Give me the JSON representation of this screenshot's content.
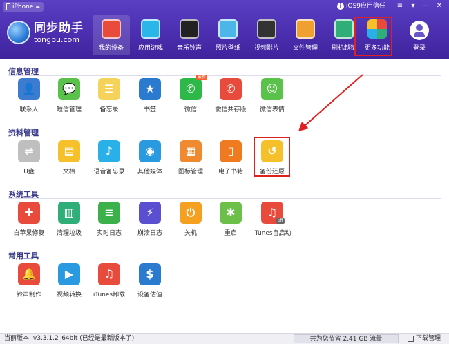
{
  "titlebar": {
    "device": "iPhone",
    "trust_text": "iOS9应用信任"
  },
  "logo": {
    "cn": "同步助手",
    "en": "tongbu.com"
  },
  "nav": [
    {
      "label": "我的设备",
      "icon": "store-icon",
      "color": "#e84a3c"
    },
    {
      "label": "应用游戏",
      "icon": "app-store-icon",
      "color": "#2ab6e8"
    },
    {
      "label": "音乐铃声",
      "icon": "vinyl-record-icon",
      "color": "#222222"
    },
    {
      "label": "照片壁纸",
      "icon": "photo-icon",
      "color": "#4db6e8"
    },
    {
      "label": "视频影片",
      "icon": "clapperboard-icon",
      "color": "#333333"
    },
    {
      "label": "文件管理",
      "icon": "envelope-icon",
      "color": "#f0a030"
    },
    {
      "label": "刷机越狱",
      "icon": "refresh-icon",
      "color": "#2fae7a"
    },
    {
      "label": "更多功能",
      "icon": "grid-icon",
      "color": "#f5c02a"
    },
    {
      "label": "登录",
      "icon": "user-icon",
      "color": "#ffffff"
    }
  ],
  "sections": [
    {
      "title": "信息管理",
      "items": [
        {
          "label": "联系人",
          "icon": "contacts-icon",
          "color": "#3b7bd0",
          "glyph": "👤"
        },
        {
          "label": "短信管理",
          "icon": "message-icon",
          "color": "#5ac24a",
          "glyph": "💬"
        },
        {
          "label": "备忘录",
          "icon": "notes-icon",
          "color": "#f5d25a",
          "glyph": "☰"
        },
        {
          "label": "书签",
          "icon": "bookmark-icon",
          "color": "#2a7bd0",
          "glyph": "★"
        },
        {
          "label": "微信",
          "icon": "wechat-icon",
          "color": "#2fb84a",
          "glyph": "✆",
          "badge": "最新"
        },
        {
          "label": "微信共存版",
          "icon": "wechat-dual-icon",
          "color": "#e84a3c",
          "glyph": "✆"
        },
        {
          "label": "微信表情",
          "icon": "smiley-icon",
          "color": "#5ac24a",
          "glyph": "☺"
        }
      ]
    },
    {
      "title": "资料管理",
      "items": [
        {
          "label": "U盘",
          "icon": "usb-drive-icon",
          "color": "#bfbfbf",
          "glyph": "⇌"
        },
        {
          "label": "文档",
          "icon": "folder-icon",
          "color": "#f5c02a",
          "glyph": "▤"
        },
        {
          "label": "语音备忘录",
          "icon": "microphone-icon",
          "color": "#2ab0e8",
          "glyph": "♪"
        },
        {
          "label": "其他媒体",
          "icon": "media-icon",
          "color": "#2a9ae0",
          "glyph": "◉"
        },
        {
          "label": "图标管理",
          "icon": "icon-grid-icon",
          "color": "#f08a30",
          "glyph": "▦"
        },
        {
          "label": "电子书籍",
          "icon": "book-icon",
          "color": "#f07a20",
          "glyph": "▯"
        },
        {
          "label": "备份还原",
          "icon": "backup-restore-icon",
          "color": "#f5c02a",
          "glyph": "↺"
        }
      ]
    },
    {
      "title": "系统工具",
      "items": [
        {
          "label": "白苹果修复",
          "icon": "apple-repair-icon",
          "color": "#e84a3c",
          "glyph": "✚"
        },
        {
          "label": "清理垃圾",
          "icon": "trash-icon",
          "color": "#2fae7a",
          "glyph": "▥"
        },
        {
          "label": "实时日志",
          "icon": "realtime-log-icon",
          "color": "#3cb04a",
          "glyph": "≡"
        },
        {
          "label": "崩溃日志",
          "icon": "crash-log-icon",
          "color": "#5a4fd0",
          "glyph": "⚡"
        },
        {
          "label": "关机",
          "icon": "power-icon",
          "color": "#f5a020",
          "glyph": "⏻"
        },
        {
          "label": "重启",
          "icon": "restart-icon",
          "color": "#6cc04a",
          "glyph": "✱"
        },
        {
          "label": "iTunes自启动",
          "icon": "itunes-auto-icon",
          "color": "#e84a3c",
          "glyph": "♫",
          "badge_off": "off"
        }
      ]
    },
    {
      "title": "常用工具",
      "items": [
        {
          "label": "铃声制作",
          "icon": "bell-icon",
          "color": "#e84a3c",
          "glyph": "🔔"
        },
        {
          "label": "视频转换",
          "icon": "video-convert-icon",
          "color": "#2a9ae0",
          "glyph": "▶"
        },
        {
          "label": "iTunes卸载",
          "icon": "itunes-uninstall-icon",
          "color": "#e84a3c",
          "glyph": "♫"
        },
        {
          "label": "设备估值",
          "icon": "valuation-icon",
          "color": "#2a7bd0",
          "glyph": "$"
        }
      ]
    }
  ],
  "statusbar": {
    "version": "当前版本: v3.3.1.2_64bit (已经是最新版本了)",
    "storage": "共为您节省  2.41 GB 流量",
    "download": "下载管理"
  },
  "colors": {
    "header": "#4b2fb0",
    "highlight": "#e02020",
    "section_title": "#3a3a8c"
  }
}
